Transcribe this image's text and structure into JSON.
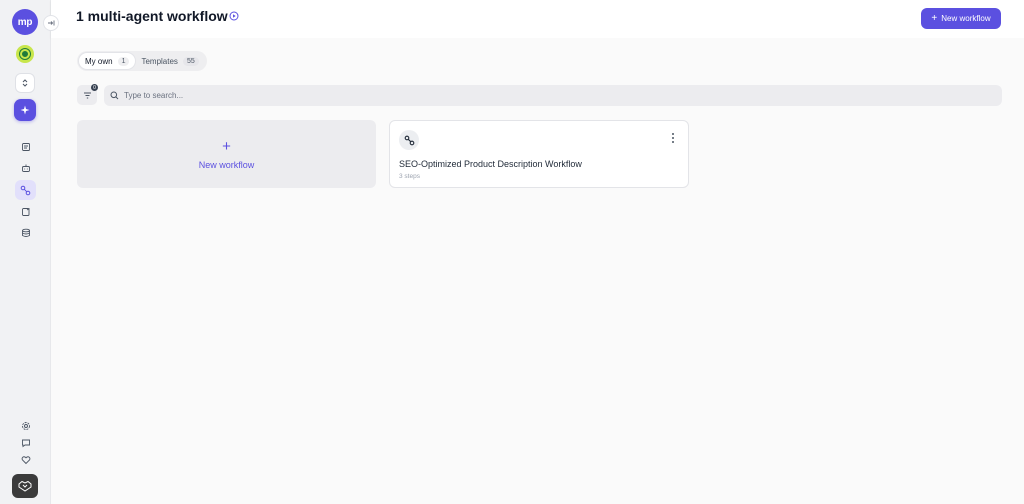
{
  "app": {
    "logo_text": "mp",
    "brand_color": "#5b50e0"
  },
  "header": {
    "title": "1 multi-agent workflow",
    "new_button_label": "New workflow"
  },
  "tabs": [
    {
      "label": "My own",
      "count": "1",
      "active": true
    },
    {
      "label": "Templates",
      "count": "55",
      "active": false
    }
  ],
  "filter": {
    "badge": "0"
  },
  "search": {
    "placeholder": "Type to search..."
  },
  "new_card": {
    "label": "New workflow"
  },
  "workflows": [
    {
      "title": "SEO-Optimized Product Description Workflow",
      "subtitle": "3 steps"
    }
  ],
  "sidebar": {
    "nav_icons": [
      "document-icon",
      "robot-icon",
      "workflow-icon",
      "notebook-icon",
      "database-icon"
    ],
    "active_nav": "workflow-icon",
    "bottom_icons": [
      "settings-icon",
      "chat-icon",
      "heart-icon"
    ]
  }
}
